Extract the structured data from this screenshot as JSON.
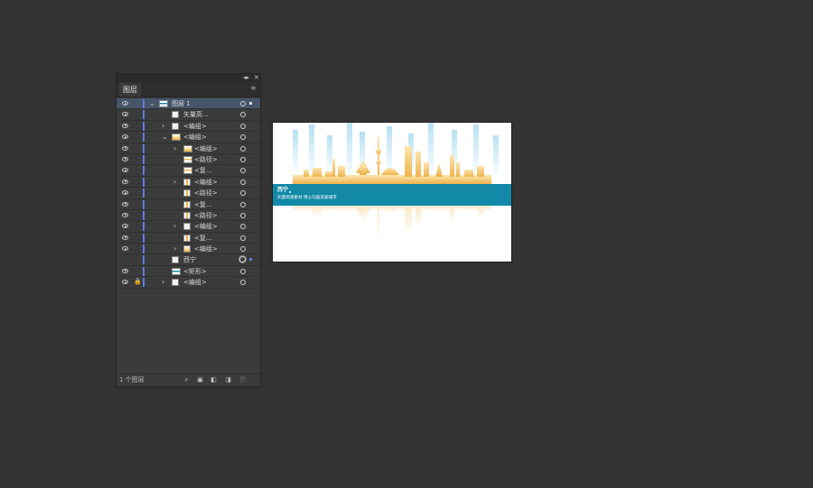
{
  "panel": {
    "tab_label": "图层",
    "collapse_glyph": "◂▸",
    "close_glyph": "✕",
    "menu_glyph": "≡",
    "footer_label": "1 个图层",
    "footer_icons": [
      "search-icon",
      "collect-for-export-icon",
      "make-clipping-mask-icon",
      "new-layer-icon",
      "delete-icon"
    ],
    "footer_glyphs": [
      "⌕",
      "▣",
      "◧",
      "◨",
      "🗑"
    ],
    "lock_glyph": "🔒",
    "expand_glyph": "›",
    "collapse_row_glyph": "⌄"
  },
  "layers": [
    {
      "name": "图层 1"
    },
    {
      "name": "矢量高..."
    },
    {
      "name": "<编组>"
    },
    {
      "name": "<编组>"
    },
    {
      "name": "<编组>"
    },
    {
      "name": "<路径>"
    },
    {
      "name": "<复..."
    },
    {
      "name": "<编组>"
    },
    {
      "name": "<路径>"
    },
    {
      "name": "<复..."
    },
    {
      "name": "<路径>"
    },
    {
      "name": "<编组>"
    },
    {
      "name": "<复..."
    },
    {
      "name": "<编组>"
    },
    {
      "name": "西宁"
    },
    {
      "name": "<矩形>"
    },
    {
      "name": "<编组>"
    }
  ],
  "artboard": {
    "logo": "西宁",
    "slogan": "矢量高清素材  用心勾画美丽城市",
    "colors": {
      "band": "#1289a6",
      "gold": "#efb24a",
      "sky": "#a6d8f0"
    }
  },
  "colors": {
    "background": "#333333",
    "panel": "#3b3b3b",
    "selection": "#46556a",
    "layer_color": "#5a7ee0"
  }
}
